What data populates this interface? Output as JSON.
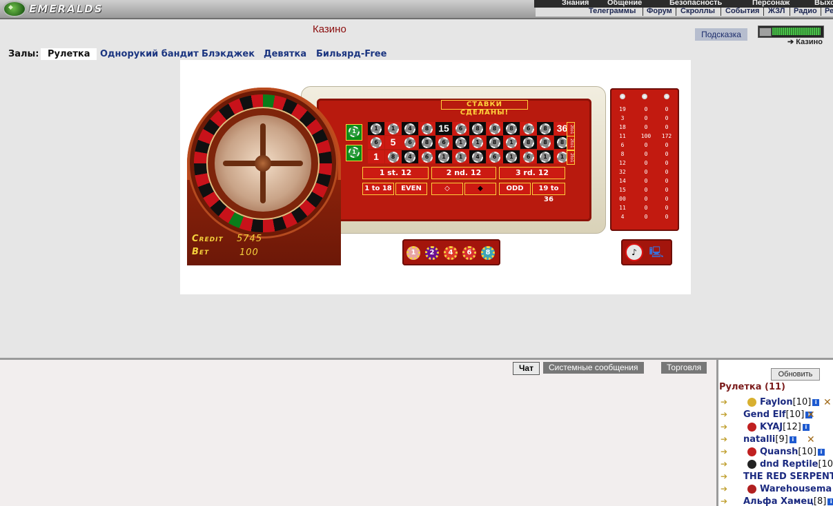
{
  "header": {
    "logo_text": "EMERALDS",
    "menu_top": [
      "Знания",
      "Общение",
      "Безопасность",
      "Персонаж",
      "Выхо"
    ],
    "menu_bottom": [
      "Телеграммы",
      "Форум",
      "Скроллы",
      "События",
      "ЖЗЛ",
      "Радио",
      "Ре"
    ]
  },
  "page": {
    "title": "Казино",
    "hint_button": "Подсказка",
    "location_link": "Казино",
    "halls_label": "Залы:",
    "halls": [
      "Рулетка",
      "Однорукий бандит",
      "Блэкджек",
      "Девятка",
      "Бильярд-Free"
    ],
    "active_hall": "Рулетка"
  },
  "game": {
    "status": "СТАВКИ СДЕЛАНЫ!",
    "credit_label": "Credit",
    "credit_value": "5745",
    "bet_label": "Bet",
    "bet_value": "100",
    "table_numbers": {
      "top": [
        {
          "n": "15",
          "c": "black",
          "pos": 4
        },
        {
          "n": "36",
          "c": "red",
          "pos": 11
        }
      ],
      "mid": [
        {
          "n": "5",
          "c": "red",
          "pos": 1
        }
      ],
      "bot": [
        {
          "n": "1",
          "c": "red",
          "pos": 0
        }
      ]
    },
    "chips_top": [
      "1",
      "1",
      "4",
      "8",
      "",
      "6",
      "8",
      "8",
      "8",
      "6",
      "8",
      ""
    ],
    "chips_mid": [
      "6",
      "",
      "6",
      "8",
      "6",
      "1",
      "1",
      "8",
      "1",
      "8",
      "8",
      "8"
    ],
    "chips_bot": [
      "",
      "8",
      "4",
      "6",
      "1",
      "1",
      "4",
      "6",
      "1",
      "6",
      "1",
      "1"
    ],
    "col_labels": [
      "2to1",
      "2to1",
      "2to1"
    ],
    "dozens": [
      "1 st. 12",
      "2 nd. 12",
      "3 rd. 12"
    ],
    "outside_bets": [
      "1 to 18",
      "EVEN",
      "",
      "",
      "ODD",
      "19 to 36"
    ],
    "tray_chips": [
      {
        "v": "1",
        "color": "#e8a3a3"
      },
      {
        "v": "2",
        "color": "#6a0f93"
      },
      {
        "v": "4",
        "color": "#e03b2b"
      },
      {
        "v": "6",
        "color": "#d83030"
      },
      {
        "v": "8",
        "color": "#3da5b8"
      }
    ],
    "history": [
      [
        "19",
        "0",
        "0"
      ],
      [
        "3",
        "0",
        "0"
      ],
      [
        "18",
        "0",
        "0"
      ],
      [
        "11",
        "100",
        "172"
      ],
      [
        "6",
        "0",
        "0"
      ],
      [
        "8",
        "0",
        "0"
      ],
      [
        "12",
        "0",
        "0"
      ],
      [
        "32",
        "0",
        "0"
      ],
      [
        "14",
        "0",
        "0"
      ],
      [
        "15",
        "0",
        "0"
      ],
      [
        "00",
        "0",
        "0"
      ],
      [
        "11",
        "0",
        "0"
      ],
      [
        "4",
        "0",
        "0"
      ]
    ]
  },
  "chat": {
    "tabs": [
      "Чат",
      "Системные сообщения",
      "Торговля"
    ],
    "active_tab": "Чат"
  },
  "userlist": {
    "refresh_button": "Обновить",
    "room": "Рулетка (11)",
    "users": [
      {
        "name": "Faylon",
        "level": "[10]",
        "badge": "#d8b030",
        "remove": true
      },
      {
        "name": "Gend Elf",
        "level": "[10]",
        "badge": "",
        "remove": true
      },
      {
        "name": "KYAJ",
        "level": "[12]",
        "badge": "#c02020",
        "remove": false
      },
      {
        "name": "natalli",
        "level": "[9]",
        "badge": "",
        "remove": true
      },
      {
        "name": "Quansh",
        "level": "[10]",
        "badge": "#c02020",
        "remove": false
      },
      {
        "name": "dnd Reptile",
        "level": "[10]",
        "badge": "#222",
        "remove": false
      },
      {
        "name": "THE RED SERPENT",
        "level": "",
        "badge": "",
        "remove": false
      },
      {
        "name": "Warehousema",
        "level": "",
        "badge": "#b02020",
        "remove": false
      },
      {
        "name": "Альфа Хамец",
        "level": "[8]",
        "badge": "",
        "remove": false
      }
    ]
  }
}
